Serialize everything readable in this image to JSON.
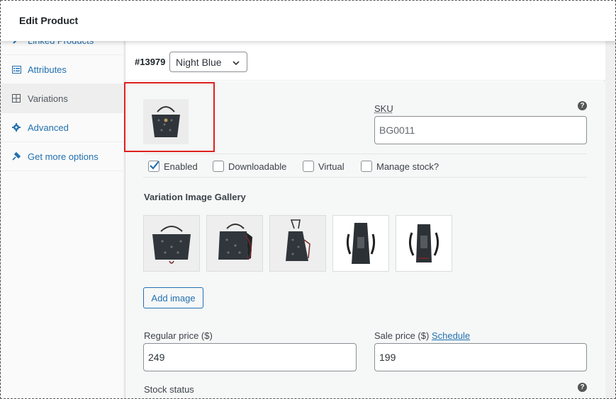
{
  "header": {
    "title": "Edit Product"
  },
  "tabs": [
    {
      "label": "Linked Products",
      "icon": "link-icon"
    },
    {
      "label": "Attributes",
      "icon": "list-icon"
    },
    {
      "label": "Variations",
      "icon": "grid-icon",
      "active": true
    },
    {
      "label": "Advanced",
      "icon": "gear-icon"
    },
    {
      "label": "Get more options",
      "icon": "plugin-icon"
    }
  ],
  "variation": {
    "id": "#13979",
    "selected": "Night Blue"
  },
  "sku": {
    "label": "SKU",
    "placeholder": "BG0011"
  },
  "checkboxes": [
    {
      "label": "Enabled",
      "checked": true
    },
    {
      "label": "Downloadable",
      "checked": false
    },
    {
      "label": "Virtual",
      "checked": false
    },
    {
      "label": "Manage stock?",
      "checked": false
    }
  ],
  "gallery": {
    "title": "Variation Image Gallery",
    "add_label": "Add image"
  },
  "pricing": {
    "regular_label": "Regular price ($)",
    "regular_value": "249",
    "sale_label": "Sale price ($)",
    "schedule_label": "Schedule",
    "sale_value": "199"
  },
  "stock": {
    "label": "Stock status"
  },
  "colors": {
    "accent": "#2271b1",
    "highlight": "#e02020"
  }
}
